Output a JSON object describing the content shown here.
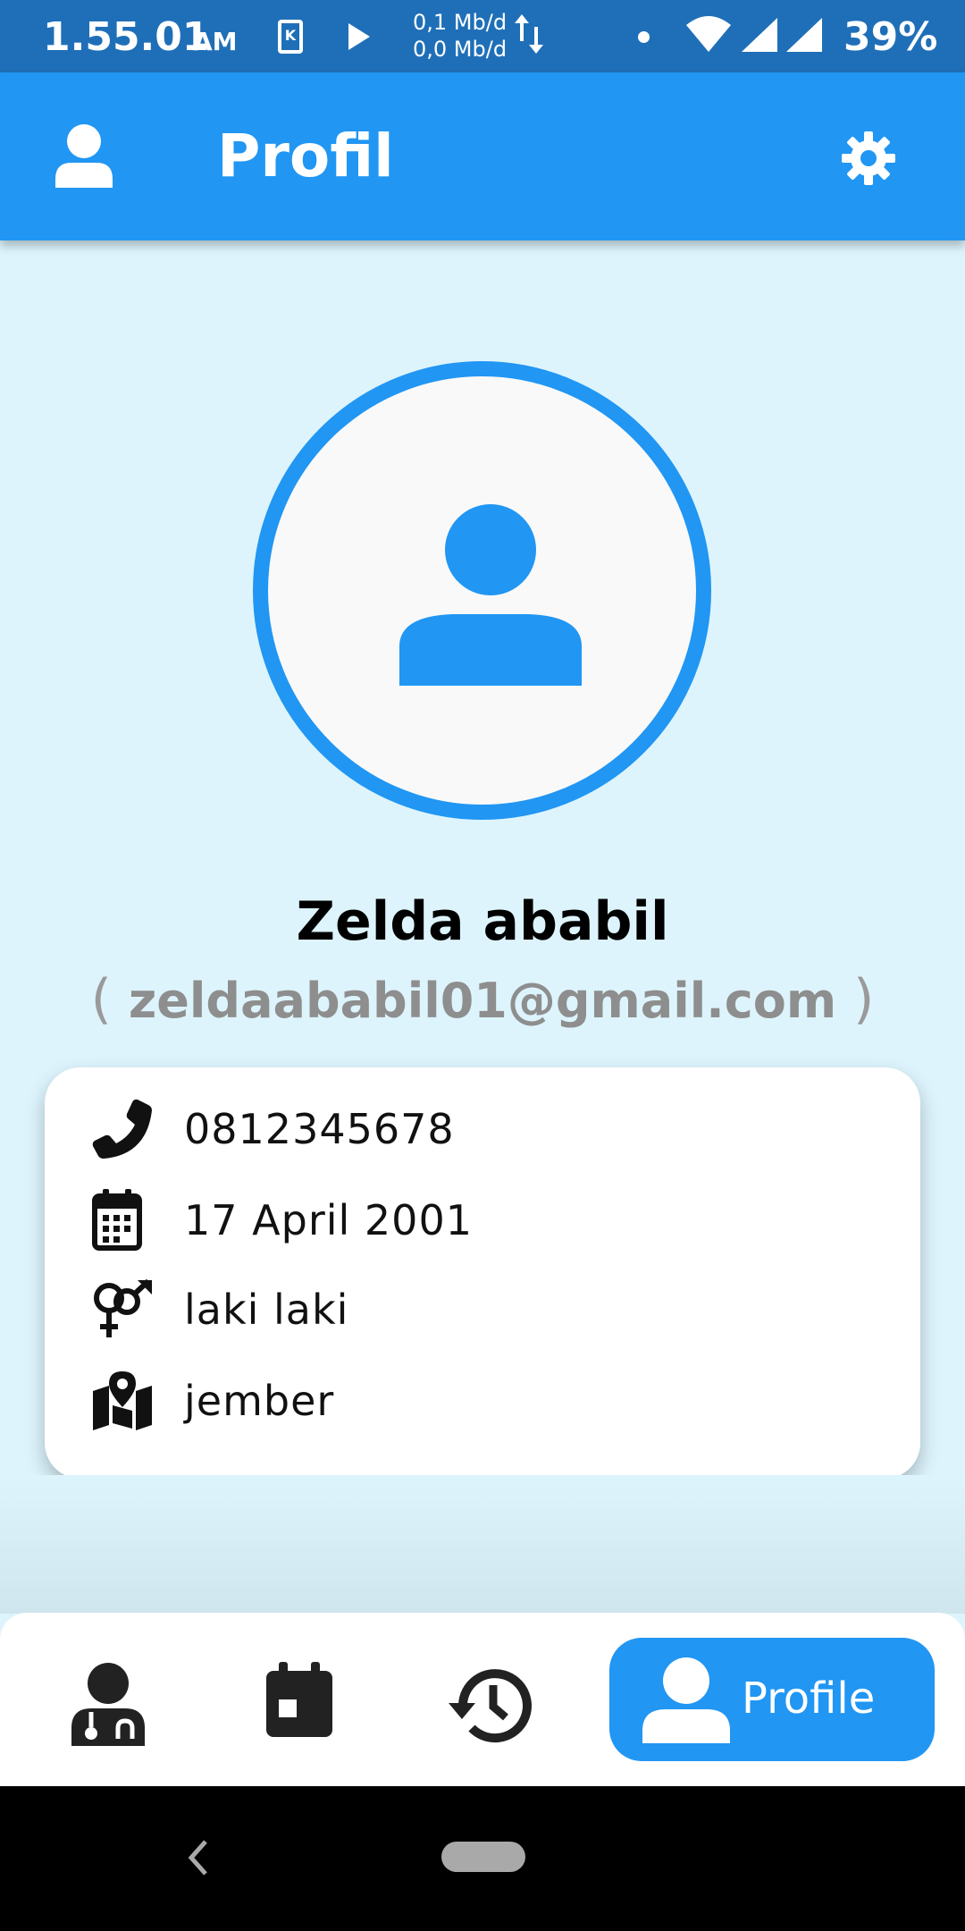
{
  "status_bar": {
    "time": "1.55.01",
    "ampm": "AM",
    "k_badge": "K",
    "speed_up": "0,1 Mb/d",
    "speed_down": "0,0 Mb/d",
    "battery": "39%"
  },
  "app_bar": {
    "title": "Profil",
    "leading_icon": "user-icon",
    "action_icon": "gear-icon"
  },
  "profile": {
    "avatar_icon": "user-icon",
    "name": "Zelda ababil",
    "email_open": "(",
    "email": "zeldaababil01@gmail.com",
    "email_close": ")"
  },
  "info": {
    "phone": "0812345678",
    "birthdate": "17 April 2001",
    "gender": "laki laki",
    "location": "jember"
  },
  "bottom_nav": {
    "items": [
      {
        "icon": "doctor-icon"
      },
      {
        "icon": "calendar-icon"
      },
      {
        "icon": "history-icon"
      },
      {
        "icon": "user-icon",
        "label": "Profile",
        "active": true
      }
    ]
  },
  "colors": {
    "primary": "#2196f3",
    "status_bar": "#1f6fb8",
    "background": "#ddf4fd",
    "email": "#8e8e8e"
  }
}
